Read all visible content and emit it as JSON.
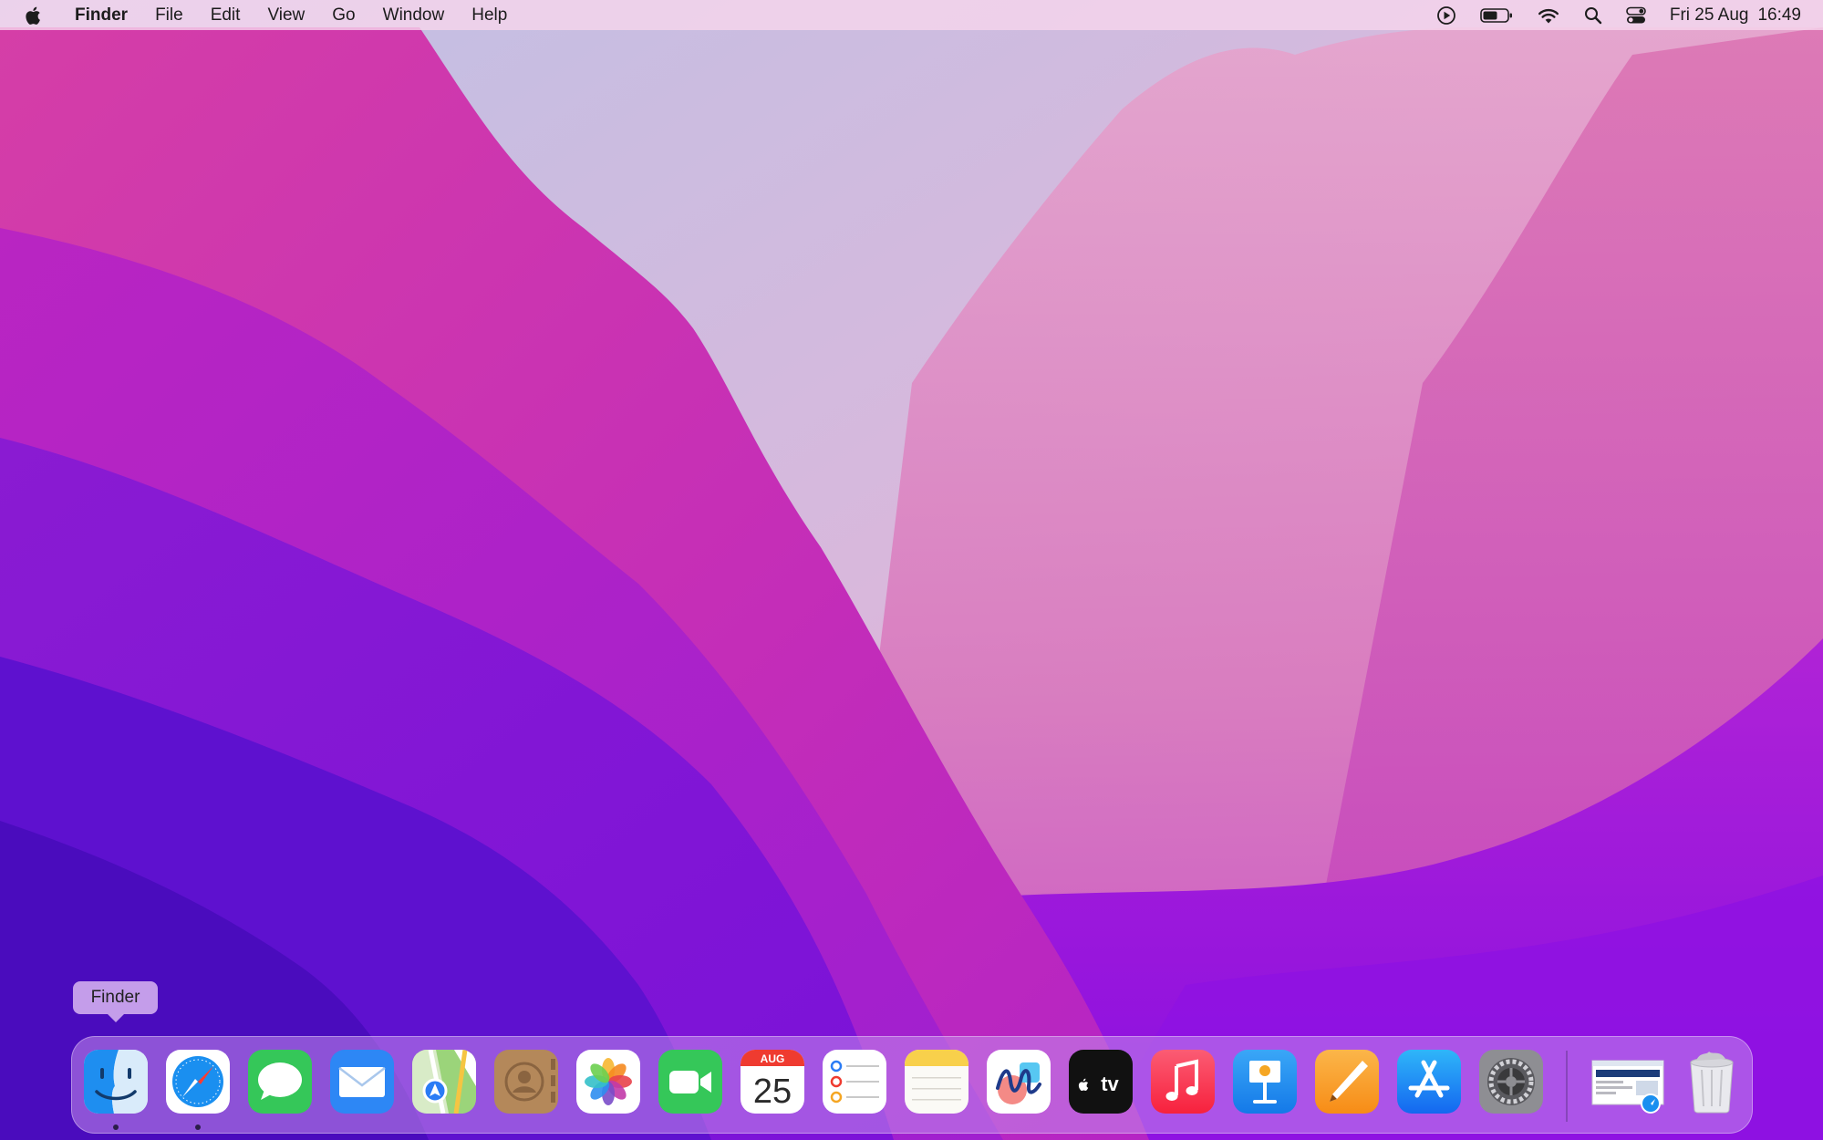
{
  "menubar": {
    "apple_icon": "apple-logo-icon",
    "app_name": "Finder",
    "menus": [
      "File",
      "Edit",
      "View",
      "Go",
      "Window",
      "Help"
    ],
    "status_icons": [
      "now-playing-icon",
      "battery-icon",
      "wifi-icon",
      "spotlight-search-icon",
      "control-center-icon"
    ],
    "date": "Fri 25 Aug",
    "time": "16:49"
  },
  "tooltip": {
    "text": "Finder"
  },
  "dock": {
    "apps": [
      {
        "name": "Finder",
        "icon": "finder-icon",
        "running": true
      },
      {
        "name": "Safari",
        "icon": "safari-icon",
        "running": true
      },
      {
        "name": "Messages",
        "icon": "messages-icon",
        "running": false
      },
      {
        "name": "Mail",
        "icon": "mail-icon",
        "running": false
      },
      {
        "name": "Maps",
        "icon": "maps-icon",
        "running": false
      },
      {
        "name": "Contacts",
        "icon": "contacts-icon",
        "running": false
      },
      {
        "name": "Photos",
        "icon": "photos-icon",
        "running": false
      },
      {
        "name": "FaceTime",
        "icon": "facetime-icon",
        "running": false
      },
      {
        "name": "Calendar",
        "icon": "calendar-icon",
        "running": false
      },
      {
        "name": "Reminders",
        "icon": "reminders-icon",
        "running": false
      },
      {
        "name": "Notes",
        "icon": "notes-icon",
        "running": false
      },
      {
        "name": "Freeform",
        "icon": "freeform-icon",
        "running": false
      },
      {
        "name": "TV",
        "icon": "apple-tv-icon",
        "running": false
      },
      {
        "name": "Music",
        "icon": "music-icon",
        "running": false
      },
      {
        "name": "Keynote",
        "icon": "keynote-icon",
        "running": false
      },
      {
        "name": "Pages",
        "icon": "pages-icon",
        "running": false
      },
      {
        "name": "App Store",
        "icon": "app-store-icon",
        "running": false
      },
      {
        "name": "System Settings",
        "icon": "system-settings-icon",
        "running": false
      }
    ],
    "calendar": {
      "month": "AUG",
      "day": "25"
    },
    "tv_label": "tv",
    "others": [
      {
        "name": "Safari web page",
        "icon": "web-page-thumbnail-icon"
      },
      {
        "name": "Trash",
        "icon": "trash-icon"
      }
    ]
  },
  "colors": {
    "menubar_bg": "#f6d6ec",
    "dock_bg": "#c48cec",
    "wallpaper_magenta": "#c42db8",
    "wallpaper_violet": "#5a10d0",
    "wallpaper_pink": "#e07cb6",
    "accent_blue": "#1e88f0"
  }
}
